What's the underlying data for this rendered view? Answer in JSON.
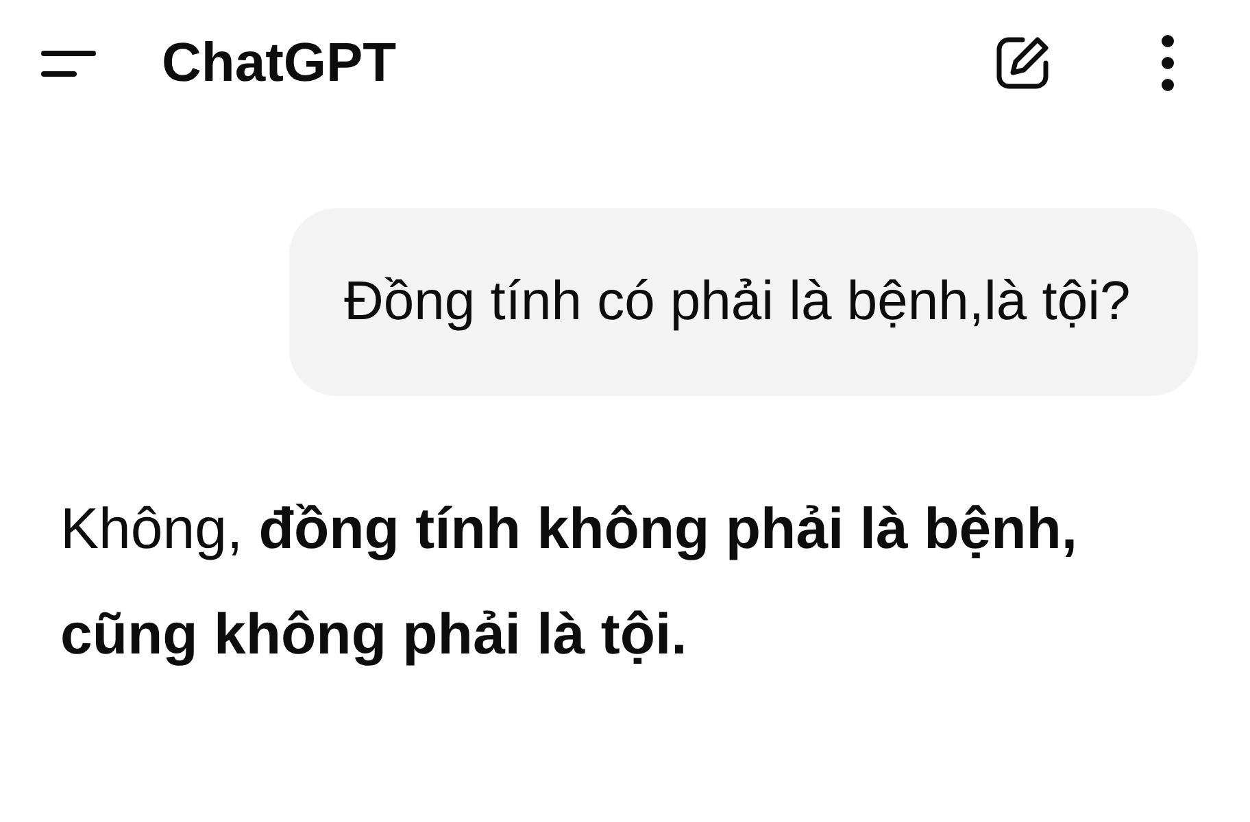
{
  "header": {
    "title": "ChatGPT"
  },
  "messages": [
    {
      "kind": "user",
      "text": "Đồng tính có phải là bệnh,là tội?"
    },
    {
      "kind": "assistant",
      "text": "Không, **đồng tính không phải là bệnh, cũng không phải là tội.**"
    }
  ]
}
